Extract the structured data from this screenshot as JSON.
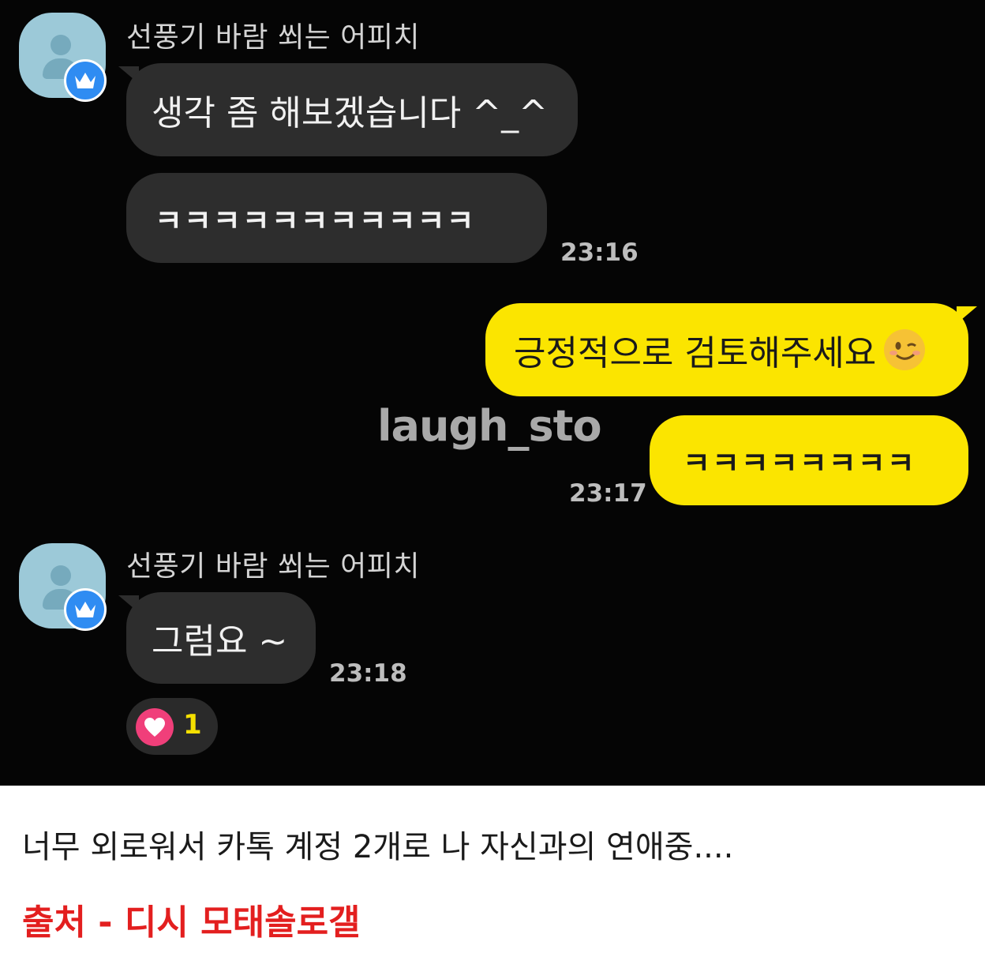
{
  "chat": {
    "messages": [
      {
        "sender": "선풍기 바람 쐬는 어피치",
        "text": "생각 좀 해보겠습니다 ^_^"
      },
      {
        "text": "ㅋㅋㅋㅋㅋㅋㅋㅋㅋㅋㅋ",
        "time": "23:16"
      },
      {
        "text": "긍정적으로 검토해주세요"
      },
      {
        "text": "ㅋㅋㅋㅋㅋㅋㅋㅋ",
        "time": "23:17"
      },
      {
        "sender": "선풍기 바람 쐬는 어피치",
        "text": "그럼요 ~",
        "time": "23:18"
      }
    ],
    "reaction": {
      "icon": "heart-icon",
      "count": "1"
    },
    "watermark": "laugh_sto"
  },
  "caption": "너무 외로워서 카톡 계정 2개로 나 자신과의 연애중....",
  "source": "출처 - 디시 모태솔로갤",
  "colors": {
    "background": "#050505",
    "incoming_bubble": "#2d2d2d",
    "outgoing_bubble": "#fbe500",
    "source_text": "#e31f1f"
  }
}
